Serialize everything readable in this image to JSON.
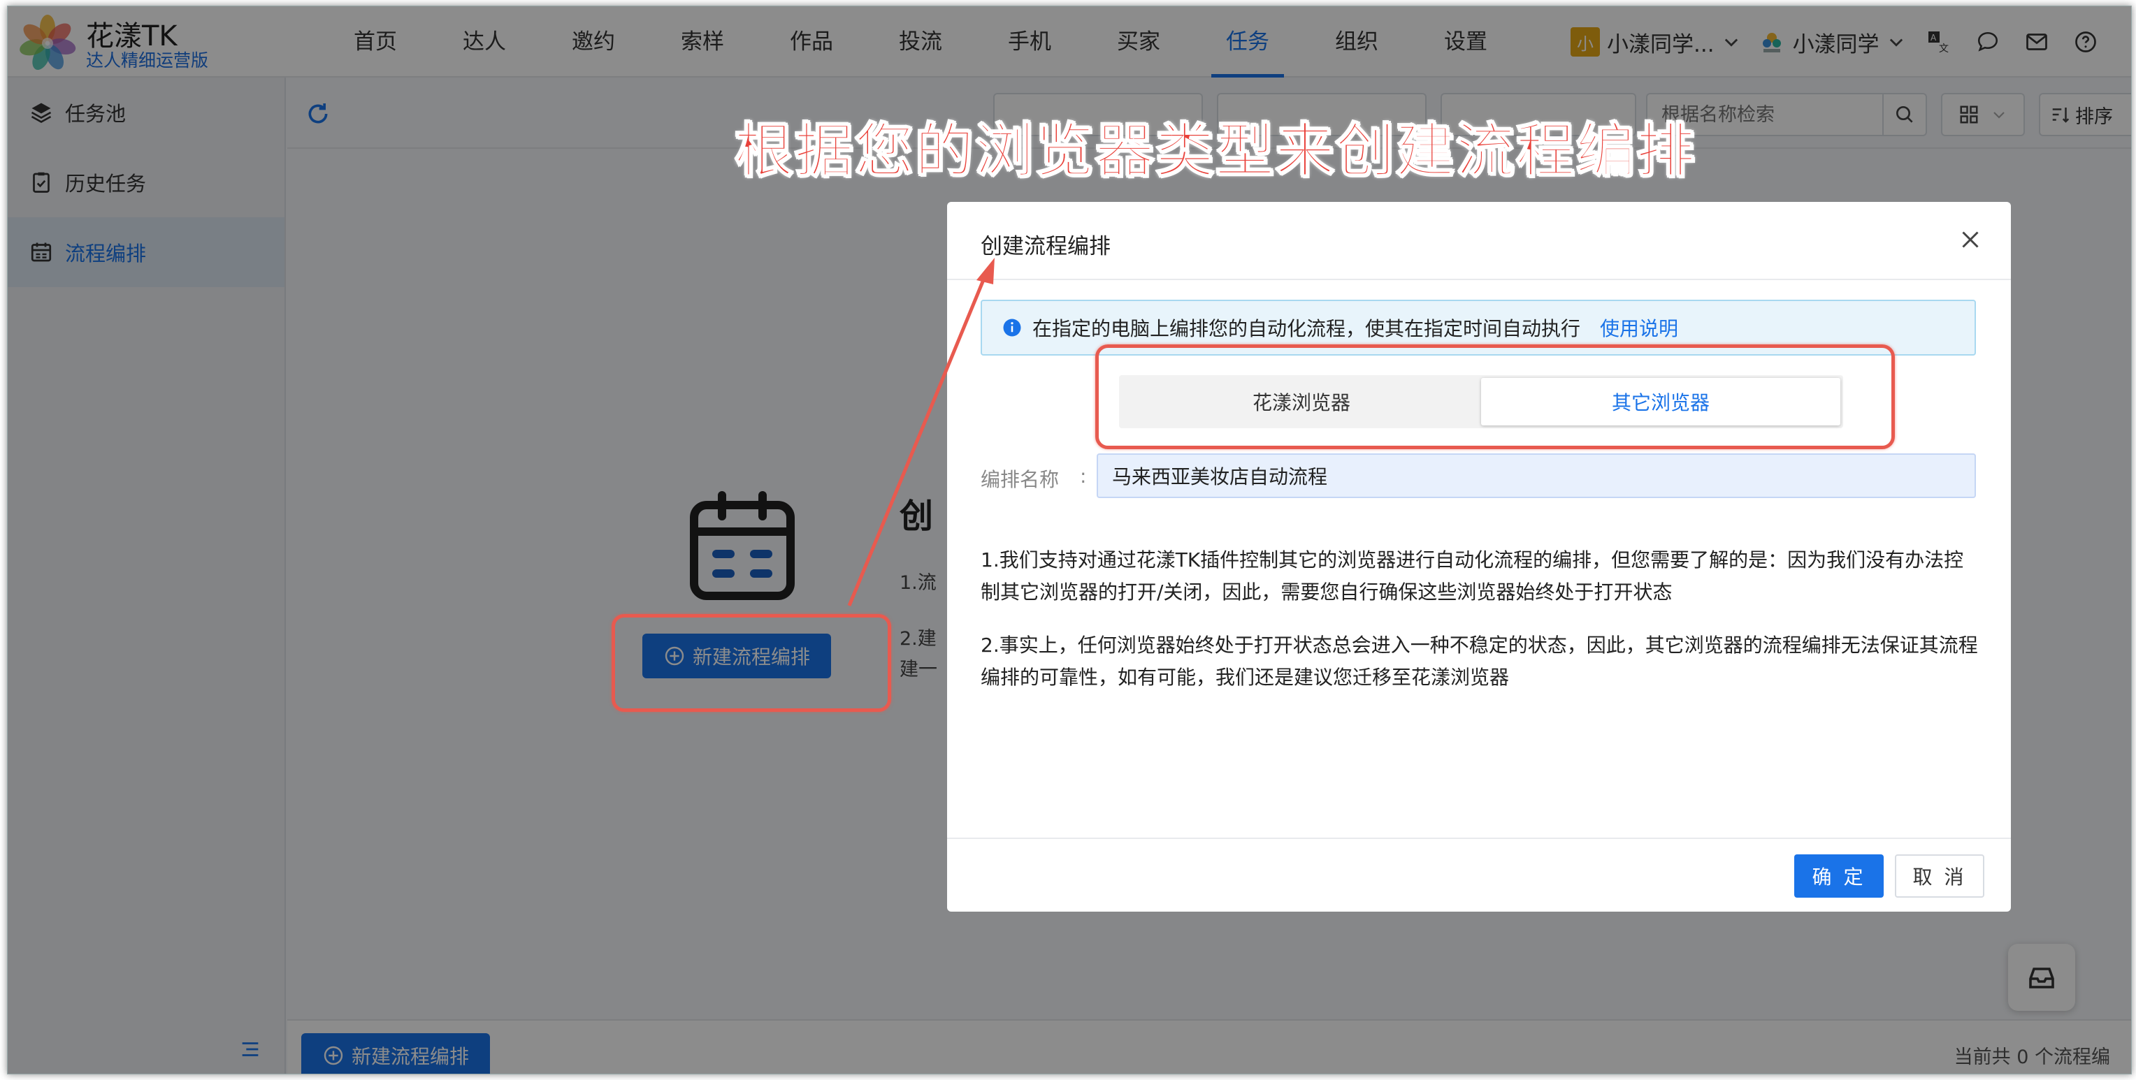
{
  "app": {
    "title": "花漾TK",
    "subtitle": "达人精细运营版"
  },
  "nav": {
    "items": [
      "首页",
      "达人",
      "邀约",
      "索样",
      "作品",
      "投流",
      "手机",
      "买家",
      "任务",
      "组织",
      "设置"
    ],
    "active": "任务"
  },
  "header_right": {
    "team_badge": "小",
    "team_name": "小漾同学...",
    "user_name": "小漾同学"
  },
  "sidebar": {
    "items": [
      {
        "label": "任务池",
        "icon": "layers-icon"
      },
      {
        "label": "历史任务",
        "icon": "clipboard-check-icon"
      },
      {
        "label": "流程编排",
        "icon": "calendar-icon"
      }
    ],
    "active": "流程编排"
  },
  "toolbar": {
    "search_placeholder": "根据名称检索",
    "sort_label": "排序"
  },
  "empty_state": {
    "title": "创",
    "line1": "1.流",
    "line2a": "2.建",
    "line2b": "建一",
    "new_button": "新建流程编排"
  },
  "footer": {
    "new_button": "新建流程编排",
    "count_text": "当前共 0 个流程编"
  },
  "modal": {
    "title": "创建流程编排",
    "info_text": "在指定的电脑上编排您的自动化流程，使其在指定时间自动执行",
    "info_link": "使用说明",
    "browser_options": [
      "花漾浏览器",
      "其它浏览器"
    ],
    "selected_browser": "其它浏览器",
    "name_label": "编排名称",
    "name_colon": ":",
    "name_value": "马来西亚美妆店自动流程",
    "note1_line1": "1.我们支持对通过花漾TK插件控制其它的浏览器进行自动化流程的编排，但您需要了解的是：因为我们没有办法控",
    "note1_line2": "制其它浏览器的打开/关闭，因此，需要您自行确保这些浏览器始终处于打开状态",
    "note2_line1": "2.事实上，任何浏览器始终处于打开状态总会进入一种不稳定的状态，因此，其它浏览器的流程编排无法保证其流程",
    "note2_line2": "编排的可靠性，如有可能，我们还是建议您迁移至花漾浏览器",
    "ok_button": "确 定",
    "cancel_button": "取 消"
  },
  "annotation": {
    "caption": "根据您的浏览器类型来创建流程编排",
    "color": "#e85a4f"
  },
  "colors": {
    "primary": "#1a73e8",
    "info_bg": "#e8f4fb",
    "logo_accent": "#e6a817"
  }
}
